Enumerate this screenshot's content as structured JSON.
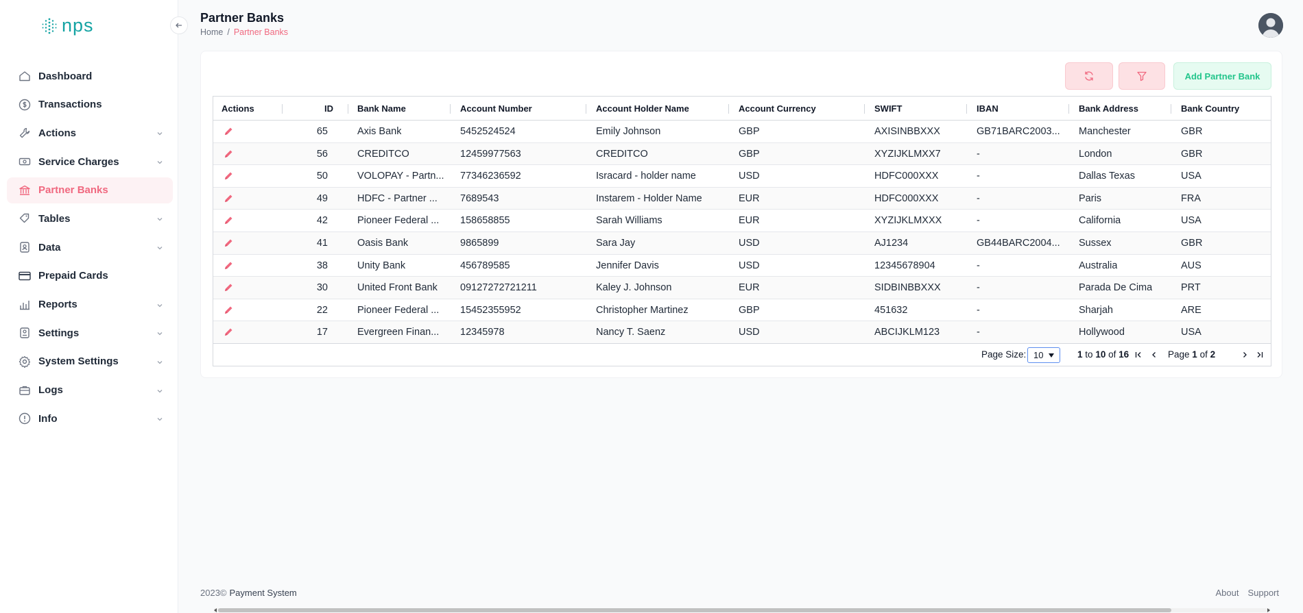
{
  "app": {
    "logo_text": "NPS"
  },
  "sidebar": {
    "items": [
      {
        "label": "Dashboard",
        "icon": "home-icon",
        "has_children": false,
        "active": false
      },
      {
        "label": "Transactions",
        "icon": "dollar-circle-icon",
        "has_children": false,
        "active": false
      },
      {
        "label": "Actions",
        "icon": "wrench-icon",
        "has_children": true,
        "active": false
      },
      {
        "label": "Service Charges",
        "icon": "cash-icon",
        "has_children": true,
        "active": false
      },
      {
        "label": "Partner Banks",
        "icon": "bank-icon",
        "has_children": false,
        "active": true
      },
      {
        "label": "Tables",
        "icon": "tag-icon",
        "has_children": true,
        "active": false
      },
      {
        "label": "Data",
        "icon": "user-card-icon",
        "has_children": true,
        "active": false
      },
      {
        "label": "Prepaid Cards",
        "icon": "credit-card-icon",
        "has_children": false,
        "active": false
      },
      {
        "label": "Reports",
        "icon": "bar-chart-icon",
        "has_children": true,
        "active": false
      },
      {
        "label": "Settings",
        "icon": "user-settings-icon",
        "has_children": true,
        "active": false
      },
      {
        "label": "System Settings",
        "icon": "gear-icon",
        "has_children": true,
        "active": false
      },
      {
        "label": "Logs",
        "icon": "briefcase-icon",
        "has_children": true,
        "active": false
      },
      {
        "label": "Info",
        "icon": "info-icon",
        "has_children": true,
        "active": false
      }
    ]
  },
  "header": {
    "title": "Partner Banks",
    "breadcrumb": {
      "home": "Home",
      "separator": "/",
      "current": "Partner Banks"
    }
  },
  "toolbar": {
    "add_label": "Add Partner Bank"
  },
  "table": {
    "columns": [
      "Actions",
      "ID",
      "Bank Name",
      "Account Number",
      "Account Holder Name",
      "Account Currency",
      "SWIFT",
      "IBAN",
      "Bank Address",
      "Bank Country"
    ],
    "rows": [
      [
        "65",
        "Axis Bank",
        "5452524524",
        "Emily Johnson",
        "GBP",
        "AXISINBBXXX",
        "GB71BARC2003...",
        "Manchester",
        "GBR"
      ],
      [
        "56",
        "CREDITCO",
        "12459977563",
        "CREDITCO",
        "GBP",
        "XYZIJKLMXX7",
        "-",
        "London",
        "GBR"
      ],
      [
        "50",
        "VOLOPAY - Partn...",
        "77346236592",
        "Isracard - holder name",
        "USD",
        "HDFC000XXX",
        "-",
        "Dallas Texas",
        "USA"
      ],
      [
        "49",
        "HDFC - Partner ...",
        "7689543",
        "Instarem - Holder Name",
        "EUR",
        "HDFC000XXX",
        "-",
        "Paris",
        "FRA"
      ],
      [
        "42",
        "Pioneer Federal ...",
        "158658855",
        "Sarah Williams",
        "EUR",
        "XYZIJKLMXXX",
        "-",
        "California",
        "USA"
      ],
      [
        "41",
        "Oasis Bank",
        "9865899",
        "Sara Jay",
        "USD",
        "AJ1234",
        "GB44BARC2004...",
        "Sussex",
        "GBR"
      ],
      [
        "38",
        "Unity Bank",
        "456789585",
        "Jennifer Davis",
        "USD",
        "12345678904",
        "-",
        "Australia",
        "AUS"
      ],
      [
        "30",
        "United Front Bank",
        "09127272721211",
        "Kaley J. Johnson",
        "EUR",
        "SIDBINBBXXX",
        "-",
        "Parada De Cima",
        "PRT"
      ],
      [
        "22",
        "Pioneer Federal ...",
        "15452355952",
        "Christopher Martinez",
        "GBP",
        "451632",
        "-",
        "Sharjah",
        "ARE"
      ],
      [
        "17",
        "Evergreen Finan...",
        "12345978",
        "Nancy T. Saenz",
        "USD",
        "ABCIJKLM123",
        "-",
        "Hollywood",
        "USA"
      ]
    ]
  },
  "pagination": {
    "page_size_label": "Page Size:",
    "page_size": "10",
    "range_from": "1",
    "range_to_word": "to",
    "range_to": "10",
    "of_word": "of",
    "total": "16",
    "page_word": "Page",
    "page": "1",
    "page_of": "of",
    "page_count": "2"
  },
  "footer": {
    "year": "2023©",
    "app_name": "Payment System",
    "links": [
      "About",
      "Support"
    ]
  },
  "colors": {
    "accent": "#f0687f",
    "brand": "#14a3a3",
    "success": "#22c58b"
  }
}
